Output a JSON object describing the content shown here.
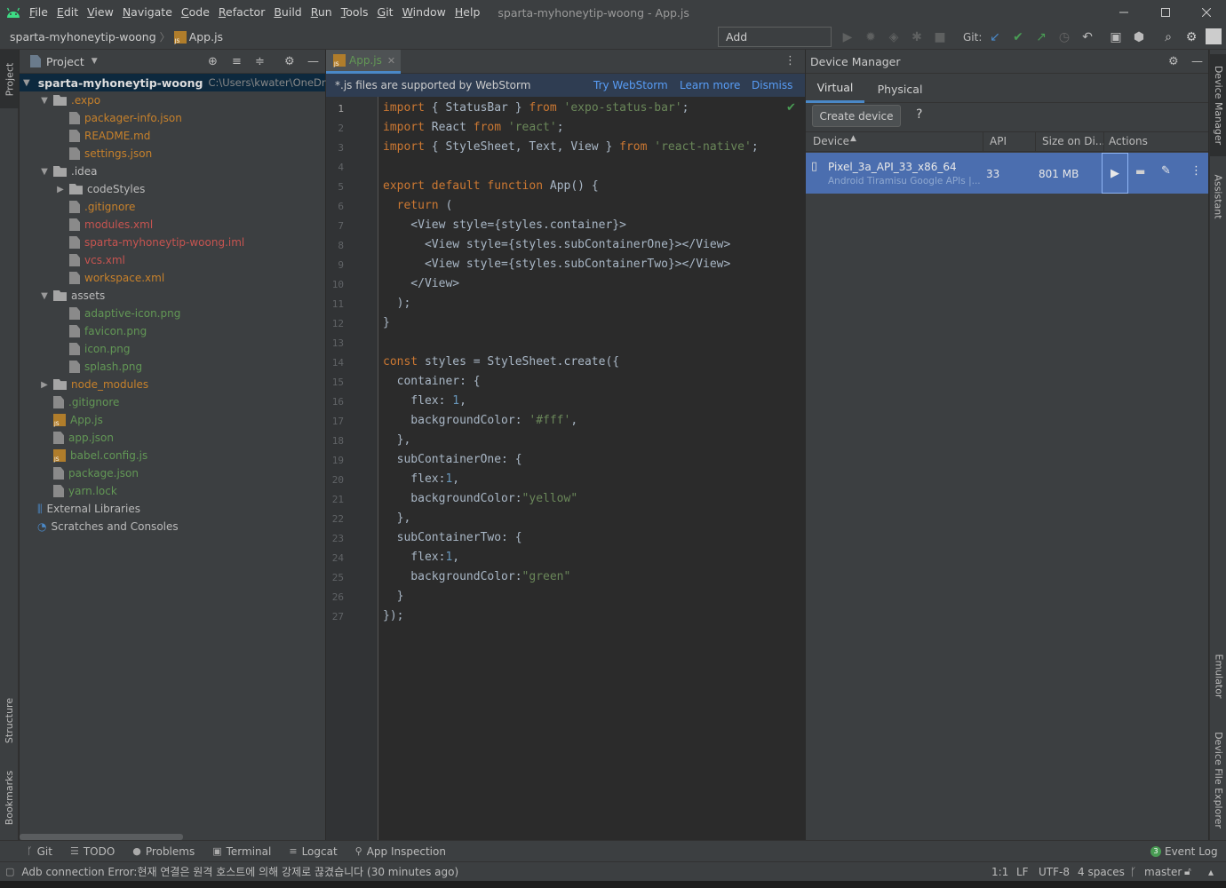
{
  "menu": [
    "File",
    "Edit",
    "View",
    "Navigate",
    "Code",
    "Refactor",
    "Build",
    "Run",
    "Tools",
    "Git",
    "Window",
    "Help"
  ],
  "window_title": "sparta-myhoneytip-woong - App.js",
  "breadcrumb": {
    "project": "sparta-myhoneytip-woong",
    "file": "App.js"
  },
  "toolbar": {
    "add_configuration": "Add Configuration...",
    "git_label": "Git:"
  },
  "left_tabs": {
    "project": "Project",
    "structure": "Structure",
    "bookmarks": "Bookmarks"
  },
  "project_panel": {
    "title": "Project",
    "root": {
      "name": "sparta-myhoneytip-woong",
      "path": "C:\\Users\\kwater\\OneDriv"
    },
    "items": [
      {
        "label": ".expo",
        "type": "folder",
        "depth": 1,
        "expanded": true,
        "color": "orange"
      },
      {
        "label": "packager-info.json",
        "type": "file",
        "depth": 2,
        "color": "orange"
      },
      {
        "label": "README.md",
        "type": "file",
        "depth": 2,
        "color": "orange"
      },
      {
        "label": "settings.json",
        "type": "file",
        "depth": 2,
        "color": "orange"
      },
      {
        "label": ".idea",
        "type": "folder",
        "depth": 1,
        "expanded": true,
        "color": "normal"
      },
      {
        "label": "codeStyles",
        "type": "folder",
        "depth": 2,
        "expanded": false,
        "color": "normal"
      },
      {
        "label": ".gitignore",
        "type": "file",
        "depth": 2,
        "color": "orange"
      },
      {
        "label": "modules.xml",
        "type": "file",
        "depth": 2,
        "color": "red"
      },
      {
        "label": "sparta-myhoneytip-woong.iml",
        "type": "file",
        "depth": 2,
        "color": "red"
      },
      {
        "label": "vcs.xml",
        "type": "file",
        "depth": 2,
        "color": "red"
      },
      {
        "label": "workspace.xml",
        "type": "file",
        "depth": 2,
        "color": "orange"
      },
      {
        "label": "assets",
        "type": "folder",
        "depth": 1,
        "expanded": true,
        "color": "normal"
      },
      {
        "label": "adaptive-icon.png",
        "type": "file",
        "depth": 2,
        "color": "green"
      },
      {
        "label": "favicon.png",
        "type": "file",
        "depth": 2,
        "color": "green"
      },
      {
        "label": "icon.png",
        "type": "file",
        "depth": 2,
        "color": "green"
      },
      {
        "label": "splash.png",
        "type": "file",
        "depth": 2,
        "color": "green"
      },
      {
        "label": "node_modules",
        "type": "folder",
        "depth": 1,
        "expanded": false,
        "color": "orange"
      },
      {
        "label": ".gitignore",
        "type": "file",
        "depth": 1,
        "color": "green"
      },
      {
        "label": "App.js",
        "type": "jsfile",
        "depth": 1,
        "color": "green"
      },
      {
        "label": "app.json",
        "type": "file",
        "depth": 1,
        "color": "green"
      },
      {
        "label": "babel.config.js",
        "type": "jsfile",
        "depth": 1,
        "color": "green"
      },
      {
        "label": "package.json",
        "type": "file",
        "depth": 1,
        "color": "green"
      },
      {
        "label": "yarn.lock",
        "type": "file",
        "depth": 1,
        "color": "green"
      },
      {
        "label": "External Libraries",
        "type": "libs",
        "depth": 0,
        "color": "normal"
      },
      {
        "label": "Scratches and Consoles",
        "type": "scratch",
        "depth": 0,
        "color": "normal"
      }
    ]
  },
  "editor": {
    "tab": "App.js",
    "banner": {
      "text": "*.js files are supported by WebStorm",
      "try": "Try WebStorm",
      "learn": "Learn more",
      "dismiss": "Dismiss"
    },
    "lines": [
      "import { StatusBar } from 'expo-status-bar';",
      "import React from 'react';",
      "import { StyleSheet, Text, View } from 'react-native';",
      "",
      "export default function App() {",
      "  return (",
      "    <View style={styles.container}>",
      "      <View style={styles.subContainerOne}></View>",
      "      <View style={styles.subContainerTwo}></View>",
      "    </View>",
      "  );",
      "}",
      "",
      "const styles = StyleSheet.create({",
      "  container: {",
      "    flex: 1,",
      "    backgroundColor: '#fff',",
      "  },",
      "  subContainerOne: {",
      "    flex:1,",
      "    backgroundColor:\"yellow\"",
      "  },",
      "  subContainerTwo: {",
      "    flex:1,",
      "    backgroundColor:\"green\"",
      "  }",
      "});"
    ]
  },
  "device_manager": {
    "title": "Device Manager",
    "tabs": [
      "Virtual",
      "Physical"
    ],
    "create_device": "Create device",
    "help": "?",
    "columns": [
      "Device",
      "API",
      "Size on Di...",
      "Actions"
    ],
    "devices": [
      {
        "name": "Pixel_3a_API_33_x86_64",
        "subtitle": "Android Tiramisu Google APIs |...",
        "api": "33",
        "size": "801 MB"
      }
    ]
  },
  "right_tabs": {
    "device_manager": "Device Manager",
    "assistant": "Assistant",
    "emulator": "Emulator",
    "device_file_explorer": "Device File Explorer"
  },
  "bottom_tools": [
    "Git",
    "TODO",
    "Problems",
    "Terminal",
    "Logcat",
    "App Inspection"
  ],
  "event_log": {
    "count": "3",
    "label": "Event Log"
  },
  "status": {
    "message": "Adb connection Error:현재 연결은 원격 호스트에 의해 강제로 끊겼습니다 (30 minutes ago)",
    "position": "1:1",
    "line_sep": "LF",
    "encoding": "UTF-8",
    "indent": "4 spaces",
    "branch": "master"
  },
  "colors": {
    "accent": "#4b6eaf",
    "keyword": "#cc7832",
    "string": "#6a8759",
    "number": "#6897bb",
    "tag": "#e8bf6a"
  }
}
